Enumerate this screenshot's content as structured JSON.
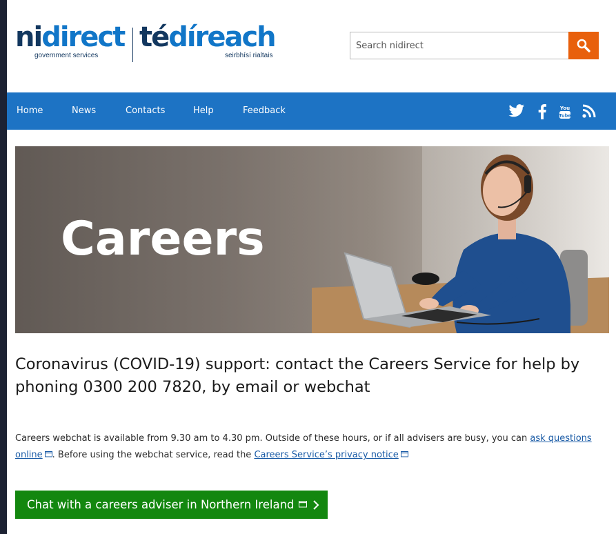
{
  "header": {
    "logo": {
      "en_prefix": "ni",
      "en_suffix": "direct",
      "en_tagline": "government services",
      "ga_prefix": "té",
      "ga_suffix": "díreach",
      "ga_tagline": "seirbhísí rialtais"
    },
    "search": {
      "placeholder": "Search nidirect",
      "button_icon": "search-icon"
    }
  },
  "nav": {
    "items": [
      {
        "label": "Home"
      },
      {
        "label": "News"
      },
      {
        "label": "Contacts"
      },
      {
        "label": "Help"
      },
      {
        "label": "Feedback"
      }
    ],
    "social": [
      "twitter-icon",
      "facebook-icon",
      "youtube-icon",
      "rss-icon"
    ]
  },
  "hero": {
    "title": "Careers"
  },
  "content": {
    "headline": "Coronavirus (COVID-19) support: contact the Careers Service for help by phoning 0300 200 7820, by email or webchat",
    "para_part1": "Careers webchat is available from 9.30 am to 4.30 pm.  Outside of these hours, or if all advisers are busy, you can ",
    "link1": "ask questions online",
    "para_part2": ". Before using the webchat service, read the ",
    "link2": "Careers Service’s privacy notice",
    "cta_label": "Chat with a careers adviser in Northern Ireland"
  },
  "colors": {
    "nav_blue": "#1d73c4",
    "search_orange": "#e8600c",
    "cta_green": "#13870f",
    "brand_navy": "#12375f",
    "brand_blue": "#1176c8",
    "link_blue": "#1a5ba6"
  }
}
